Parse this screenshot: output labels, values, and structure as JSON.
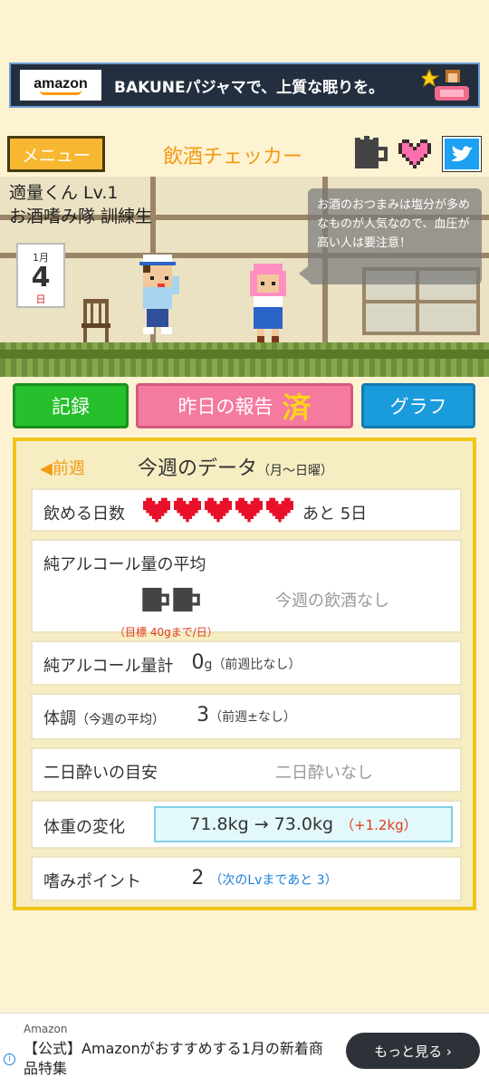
{
  "top_ad": {
    "logo": "amazon",
    "text": "BAKUNEパジャマで、上質な眠りを。",
    "icon": "sleeping-person-icon"
  },
  "header": {
    "menu_label": "メニュー",
    "title": "飲酒チェッカー",
    "icons": [
      "beer-mug-icon",
      "heart-icon",
      "twitter-icon"
    ]
  },
  "scene": {
    "user_name": "適量くん Lv.1",
    "rank": "お酒嗜み隊 訓練生",
    "calendar": {
      "month": "1月",
      "day": "4",
      "weekday": "日"
    },
    "tip": "お酒のおつまみは塩分が多めなものが人気なので、血圧が高い人は要注意！"
  },
  "tabs": {
    "record": "記録",
    "report": "昨日の報告",
    "report_mark": "済",
    "graph": "グラフ"
  },
  "week": {
    "prev_label": "◀前週",
    "title": "今週のデータ",
    "subtitle": "（月〜日曜）",
    "drinkable_days": {
      "label": "飲める日数",
      "hearts": 5,
      "remaining": "あと 5日"
    },
    "avg_alcohol": {
      "label": "純アルコール量の平均",
      "status": "今週の飲酒なし",
      "target": "（目標 40gまで/日）"
    },
    "total_alcohol": {
      "label": "純アルコール量計",
      "value": "0",
      "unit": "g",
      "note": "（前週比なし）"
    },
    "condition": {
      "label": "体調",
      "label_sub": "（今週の平均）",
      "value": "3",
      "note": "（前週±なし）"
    },
    "hangover": {
      "label": "二日酔いの目安",
      "value": "二日酔いなし"
    },
    "weight": {
      "label": "体重の変化",
      "value": "71.8kg → 73.0kg",
      "diff": "（+1.2kg）"
    },
    "points": {
      "label": "嗜みポイント",
      "value": "2",
      "note": "（次のLvまであと 3）"
    }
  },
  "bottom_ad": {
    "sponsor": "Amazon",
    "title": "【公式】Amazonがおすすめする1月の新着商品特集",
    "button": "もっと見る ›"
  },
  "colors": {
    "accent": "#f29a12",
    "heart": "#e8102a",
    "record": "#25c02b",
    "report": "#f47aa0",
    "graph": "#1a9bdc",
    "panel_border": "#f0c419"
  }
}
